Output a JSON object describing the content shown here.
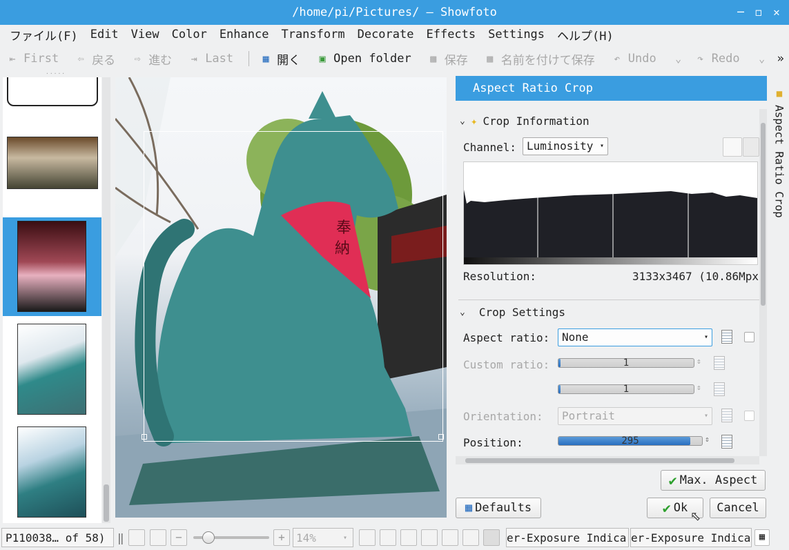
{
  "window": {
    "title": "/home/pi/Pictures/ — Showfoto"
  },
  "menu": [
    "ファイル(F)",
    "Edit",
    "View",
    "Color",
    "Enhance",
    "Transform",
    "Decorate",
    "Effects",
    "Settings",
    "ヘルプ(H)"
  ],
  "toolbar": {
    "first": "First",
    "back": "戻る",
    "forward": "進む",
    "last": "Last",
    "open": "開く",
    "open_folder": "Open folder",
    "save": "保存",
    "save_as": "名前を付けて保存",
    "undo": "Undo",
    "redo": "Redo",
    "overflow": "»"
  },
  "panel": {
    "title": "Aspect Ratio Crop",
    "crop_info": {
      "title": "Crop Information",
      "channel_label": "Channel:",
      "channel_value": "Luminosity",
      "resolution_label": "Resolution:",
      "resolution_value": "3133x3467 (10.86Mpx"
    },
    "crop_settings": {
      "title": "Crop Settings",
      "aspect_label": "Aspect ratio:",
      "aspect_value": "None",
      "custom_label": "Custom ratio:",
      "custom_num": "1",
      "custom_den": "1",
      "orientation_label": "Orientation:",
      "orientation_value": "Portrait",
      "position_label": "Position:",
      "position_value": "295",
      "position_fraction": 0.92
    },
    "buttons": {
      "max_aspect": "Max. Aspect",
      "defaults": "Defaults",
      "ok": "Ok",
      "cancel": "Cancel"
    }
  },
  "side_tab": {
    "label": "Aspect Ratio Crop"
  },
  "status": {
    "file": "P110038… of 58)",
    "zoom": "14%",
    "zoom_fraction": 0.12,
    "under_exposure": "er-Exposure Indica",
    "over_exposure": "er-Exposure Indica"
  },
  "colors": {
    "accent": "#3a9de0",
    "teal": "#3e8f8f",
    "red": "#e02e55"
  }
}
